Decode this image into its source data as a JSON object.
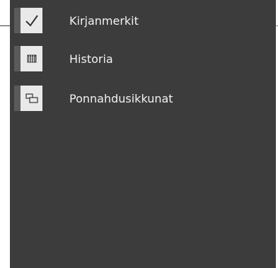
{
  "menu": {
    "items": [
      {
        "label": "Kirjanmerkit",
        "icon": "checkmark-icon",
        "checked": true
      },
      {
        "label": "Historia",
        "icon": "history-grid-icon",
        "checked": false
      },
      {
        "label": "Ponnahdusikkunat",
        "icon": "popup-windows-icon",
        "checked": false
      }
    ]
  },
  "colors": {
    "panel_background": "#3c3c3c",
    "checkbox_background": "#e9e9e9",
    "checkbox_left_bar": "#5a5a5a",
    "label_text": "#f2f2f2"
  }
}
